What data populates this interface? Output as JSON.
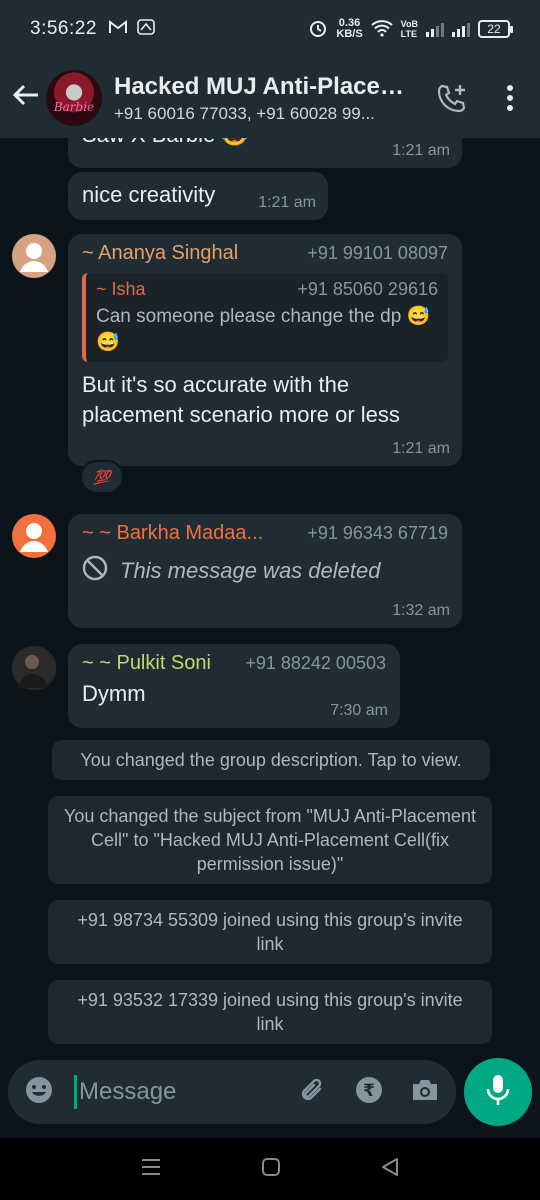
{
  "status_bar": {
    "time": "3:56:22",
    "speed_value": "0.36",
    "speed_unit": "KB/S",
    "volte_top": "VoB",
    "volte_bottom": "LTE",
    "battery": "22"
  },
  "header": {
    "avatar_text": "Barbie",
    "title": "Hacked MUJ Anti-Placement Cell(fix permission issue)",
    "subtitle": "+91 60016 77033, +91 60028 99..."
  },
  "messages": {
    "partial": {
      "text": "Saw X Barbie 😂",
      "time": "1:21 am"
    },
    "nice": {
      "text": "nice creativity",
      "time": "1:21 am"
    },
    "ananya": {
      "sender": "~ Ananya Singhal",
      "phone": "+91 99101 08097",
      "quote_sender": "~ Isha",
      "quote_phone": "+91 85060 29616",
      "quote_text": "Can someone please change the dp 😅😅",
      "text": "But it's so accurate with the placement scenario more or less",
      "time": "1:21 am",
      "reaction": "💯"
    },
    "barkha": {
      "sender": "~ ~ Barkha Madaa...",
      "phone": "+91 96343 67719",
      "text": "This message was deleted",
      "time": "1:32 am"
    },
    "pulkit": {
      "sender": "~ ~ Pulkit Soni",
      "phone": "+91 88242 00503",
      "text": "Dymm",
      "time": "7:30 am"
    }
  },
  "system_messages": [
    "You changed the group description. Tap to view.",
    "You changed the subject from \"MUJ Anti-Placement Cell\" to \"Hacked MUJ Anti-Placement Cell(fix permission issue)\"",
    "+91 98734 55309 joined using this group's invite link",
    "+91 93532 17339 joined using this group's invite link"
  ],
  "input": {
    "placeholder": "Message",
    "currency_symbol": "₹"
  },
  "colors": {
    "accent": "#00a884",
    "ananya_name": "#e8a06a",
    "isha_name": "#e26a49",
    "barkha_name": "#f2703e",
    "pulkit_name": "#c6d96a"
  }
}
